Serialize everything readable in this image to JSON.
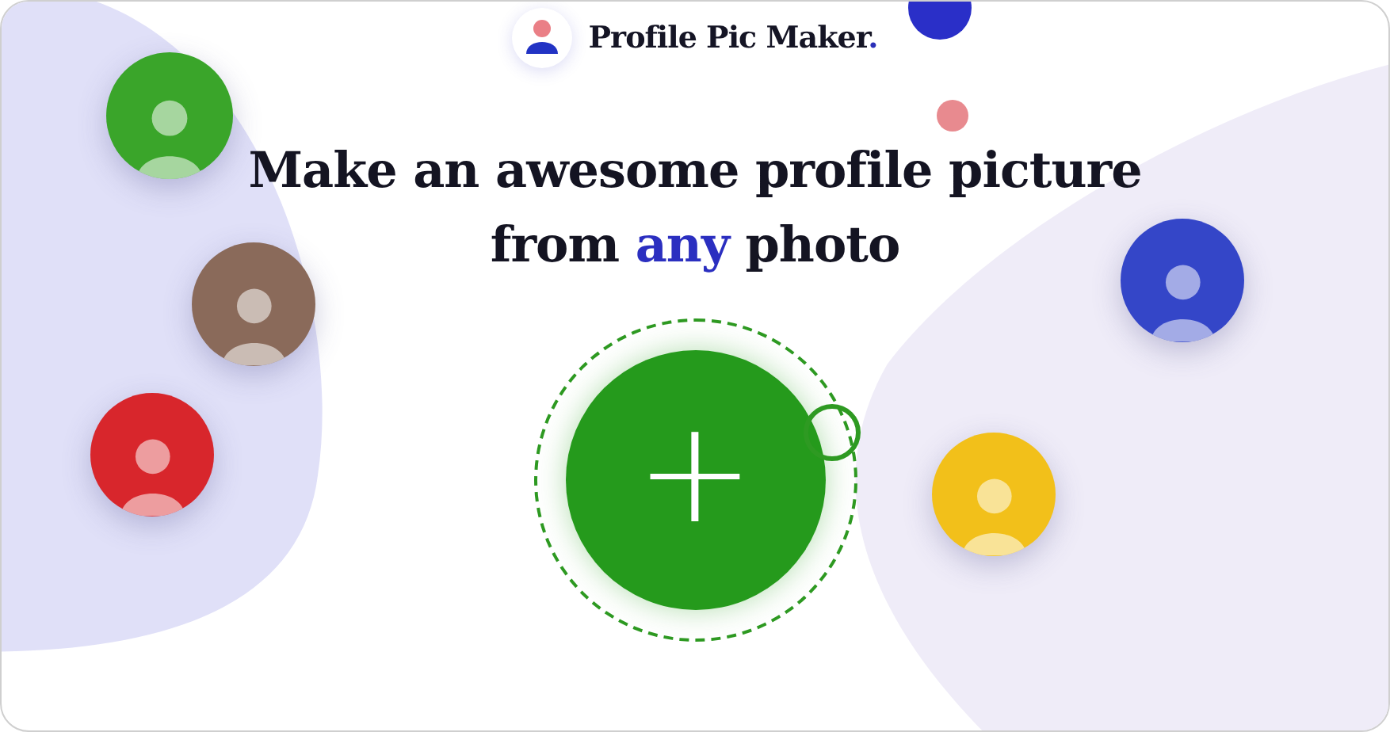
{
  "brand": {
    "name": "Profile Pic Maker",
    "dot": "."
  },
  "headline": {
    "line_1": "Make an awesome profile picture",
    "line_2_before": "from ",
    "line_2_highlight": "any",
    "line_2_after": " photo"
  },
  "upload_button": {
    "symbol": "+"
  },
  "avatars": [
    {
      "color": "#3aa52a"
    },
    {
      "color": "#8a6a5a"
    },
    {
      "color": "#d8262c"
    },
    {
      "color": "#3446c8"
    },
    {
      "color": "#f2c01a"
    }
  ]
}
